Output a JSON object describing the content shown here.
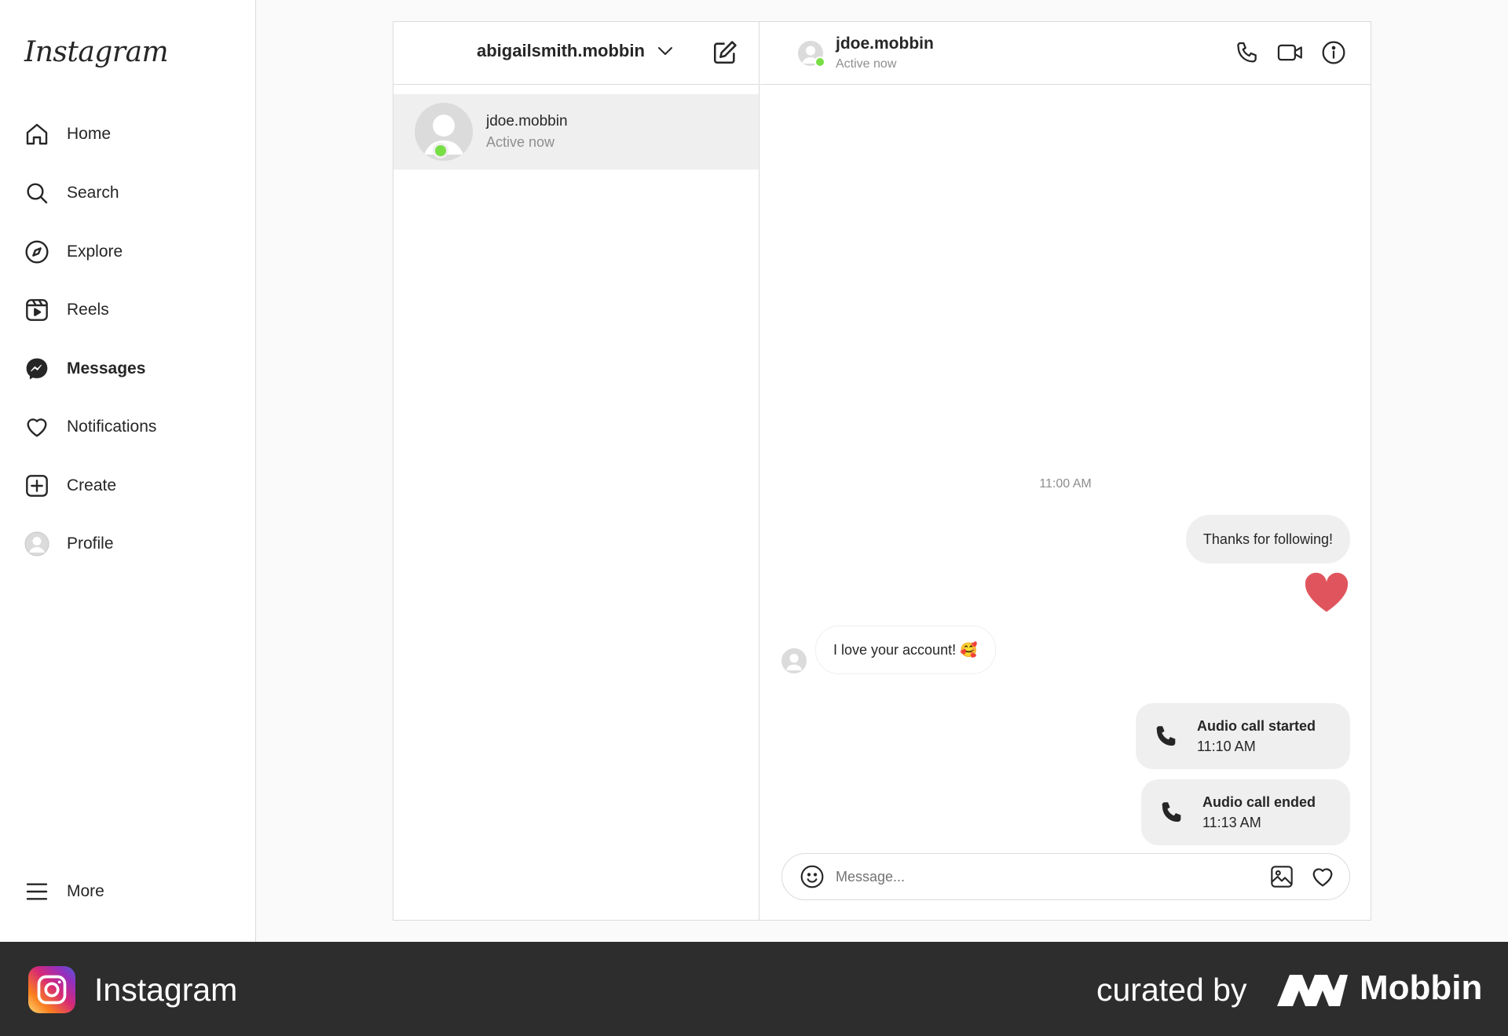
{
  "sidebar": {
    "logo": "Instagram",
    "items": [
      {
        "label": "Home",
        "icon": "home-icon"
      },
      {
        "label": "Search",
        "icon": "search-icon"
      },
      {
        "label": "Explore",
        "icon": "compass-icon"
      },
      {
        "label": "Reels",
        "icon": "reels-icon"
      },
      {
        "label": "Messages",
        "icon": "messenger-icon",
        "active": true
      },
      {
        "label": "Notifications",
        "icon": "heart-icon"
      },
      {
        "label": "Create",
        "icon": "plus-square-icon"
      },
      {
        "label": "Profile",
        "icon": "avatar-icon"
      }
    ],
    "more_label": "More"
  },
  "inbox": {
    "account_name": "abigailsmith.mobbin",
    "threads": [
      {
        "name": "jdoe.mobbin",
        "status": "Active now",
        "online": true
      }
    ]
  },
  "chat": {
    "name": "jdoe.mobbin",
    "status": "Active now",
    "timestamp": "11:00 AM",
    "outgoing_message": "Thanks for following!",
    "reaction": "heart",
    "incoming_message": "I love your account! 🥰",
    "calls": [
      {
        "title": "Audio call started",
        "time": "11:10 AM"
      },
      {
        "title": "Audio call ended",
        "time": "11:13 AM"
      }
    ],
    "composer_placeholder": "Message..."
  },
  "banner": {
    "app_name": "Instagram",
    "curated_by": "curated by",
    "brand": "Mobbin"
  },
  "colors": {
    "online": "#78de45",
    "heart": "#e0555d",
    "banner_bg": "#2d2d2d",
    "bubble_bg": "#efefef"
  }
}
